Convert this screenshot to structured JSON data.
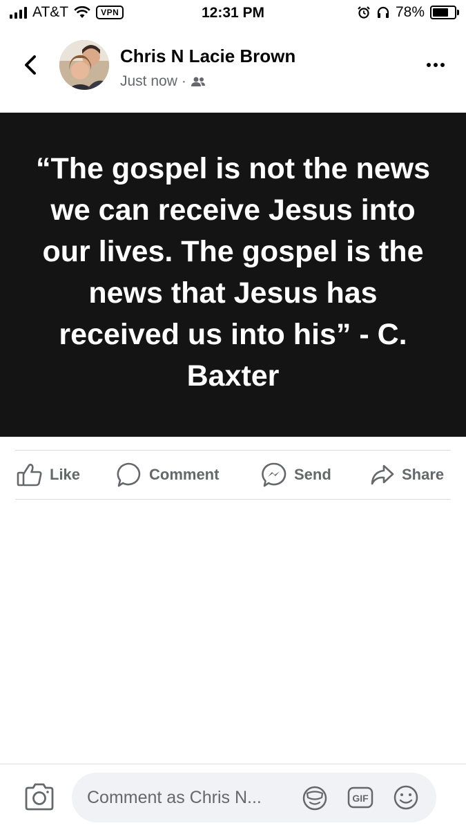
{
  "status_bar": {
    "carrier": "AT&T",
    "vpn": "VPN",
    "time": "12:31 PM",
    "battery": "78%",
    "battery_level": 0.78
  },
  "post": {
    "author": "Chris N Lacie Brown",
    "timestamp": "Just now",
    "separator": "·",
    "audience_icon": "friends-icon",
    "quote": "“The gospel is not the news we can receive Jesus into our lives. The gospel is the news that Jesus has received us into his” - C. Baxter"
  },
  "actions": {
    "like": "Like",
    "comment": "Comment",
    "send": "Send",
    "share": "Share"
  },
  "composer": {
    "placeholder": "Comment as Chris N..."
  },
  "colors": {
    "card_bg": "#141414",
    "muted": "#65676b",
    "input_bg": "#f0f2f5"
  }
}
